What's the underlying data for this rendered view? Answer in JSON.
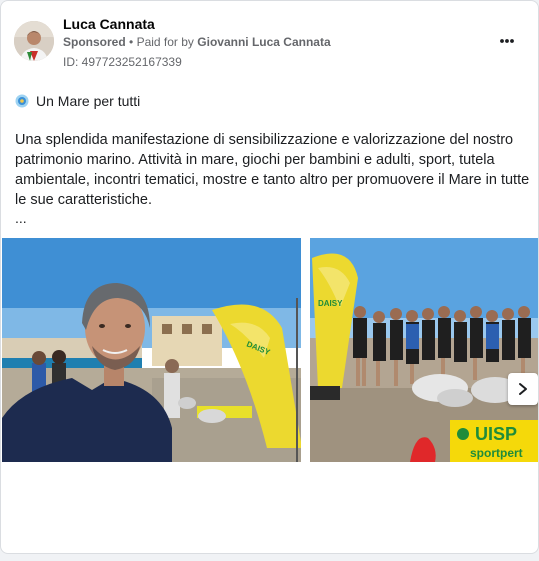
{
  "post": {
    "author": "Luca Cannata",
    "sponsored_label": "Sponsored",
    "separator": "•",
    "paid_prefix": "Paid for by",
    "paid_by": "Giovanni Luca Cannata",
    "ad_id": "ID: 497723252167339",
    "page_name": "Un Mare per tutti",
    "text": "Una splendida manifestazione di sensibilizzazione e valorizzazione del nostro patrimonio marino. Attività in mare, giochi per bambini e adulti, sport, tutela ambientale, incontri tematici, mostre e tanto altro per promuovere il Mare in tutte le sue caratteristiche.",
    "truncation": "..."
  },
  "photos": {
    "banner1_text": "DAISY",
    "banner2_text": "DAISY",
    "banner_uisp_text": "UISP",
    "banner_uisp_sub": "sportpert"
  },
  "icons": {
    "more": "more-options-icon",
    "page_dot": "page-globe-icon",
    "next": "chevron-right-icon"
  },
  "colors": {
    "text_primary": "#1c1e21",
    "text_secondary": "#65676b",
    "card_border": "#dadde1",
    "uisp_yellow": "#f5d90a",
    "uisp_green": "#1f8c3a"
  }
}
